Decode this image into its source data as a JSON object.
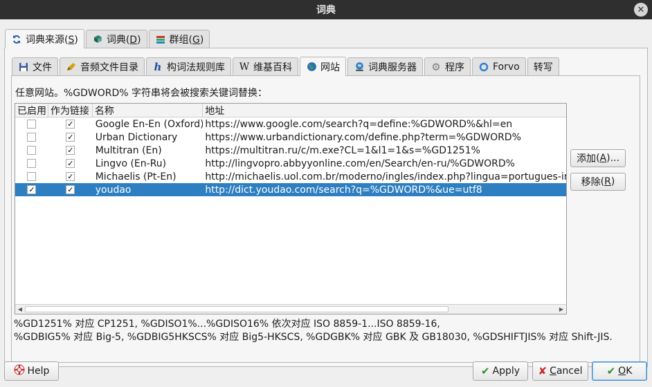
{
  "window": {
    "title": "词典"
  },
  "outer_tabs": [
    {
      "label": "词典来源",
      "mnemonic": "S",
      "icon": "refresh-icon",
      "active": true
    },
    {
      "label": "词典",
      "mnemonic": "D",
      "icon": "book-icon",
      "active": false
    },
    {
      "label": "群组",
      "mnemonic": "G",
      "icon": "books-icon",
      "active": false
    }
  ],
  "inner_tabs": [
    {
      "label": "文件",
      "icon": "disk-icon",
      "active": false
    },
    {
      "label": "音频文件目录",
      "icon": "pencil-icon",
      "active": false
    },
    {
      "label": "构词法规则库",
      "icon": "hunspell-icon",
      "glyph": "h",
      "active": false
    },
    {
      "label": "维基百科",
      "icon": "wikipedia-icon",
      "glyph": "W",
      "active": false
    },
    {
      "label": "网站",
      "icon": "globe-icon",
      "active": true
    },
    {
      "label": "词典服务器",
      "icon": "network-icon",
      "active": false
    },
    {
      "label": "程序",
      "icon": "gear-icon",
      "active": false
    },
    {
      "label": "Forvo",
      "icon": "forvo-icon",
      "active": false
    },
    {
      "label": "转写",
      "icon": "",
      "active": false
    }
  ],
  "websites": {
    "instruction": "任意网站。%GDWORD% 字符串将会被搜索关键词替换：",
    "columns": {
      "enabled": "已启用",
      "as_link": "作为链接",
      "name": "名称",
      "address": "地址"
    },
    "rows": [
      {
        "enabled": false,
        "as_link": true,
        "name": "Google En-En (Oxford)",
        "url": "https://www.google.com/search?q=define:%GDWORD%&hl=en",
        "selected": false
      },
      {
        "enabled": false,
        "as_link": true,
        "name": "Urban Dictionary",
        "url": "https://www.urbandictionary.com/define.php?term=%GDWORD%",
        "selected": false
      },
      {
        "enabled": false,
        "as_link": true,
        "name": "Multitran (En)",
        "url": "https://multitran.ru/c/m.exe?CL=1&l1=1&s=%GD1251%",
        "selected": false
      },
      {
        "enabled": false,
        "as_link": true,
        "name": "Lingvo (En-Ru)",
        "url": "http://lingvopro.abbyyonline.com/en/Search/en-ru/%GDWORD%",
        "selected": false
      },
      {
        "enabled": false,
        "as_link": true,
        "name": "Michaelis (Pt-En)",
        "url": "http://michaelis.uol.com.br/moderno/ingles/index.php?lingua=portugues-ingle",
        "selected": false
      },
      {
        "enabled": true,
        "as_link": true,
        "name": "youdao",
        "url": "http://dict.youdao.com/search?q=%GDWORD%&ue=utf8",
        "selected": true
      }
    ],
    "add_button": {
      "label": "添加",
      "mnemonic": "A",
      "suffix": "..."
    },
    "remove_button": {
      "label": "移除",
      "mnemonic": "R",
      "suffix": ""
    },
    "note_line1": "%GD1251% 对应 CP1251, %GDISO1%...%GDISO16% 依次对应 ISO 8859-1...ISO 8859-16,",
    "note_line2": "%GDBIG5% 对应 Big-5, %GDBIG5HKSCS% 对应 Big5-HKSCS, %GDGBK% 对应 GBK 及 GB18030, %GDSHIFTJIS% 对应 Shift-JIS."
  },
  "buttons": {
    "help": {
      "label": "Help",
      "icon": "lifebuoy-icon"
    },
    "apply": {
      "label": "Apply",
      "icon": "check-icon"
    },
    "cancel": {
      "label": "Cancel",
      "mnemonic": "C",
      "icon": "x-icon"
    },
    "ok": {
      "label": "OK",
      "mnemonic": "O",
      "icon": "check-icon"
    }
  },
  "colors": {
    "selection": "#2d7fc1",
    "titlebar": "#2f2f2f",
    "check_green": "#2e8b2e",
    "cancel_red": "#c62828"
  }
}
